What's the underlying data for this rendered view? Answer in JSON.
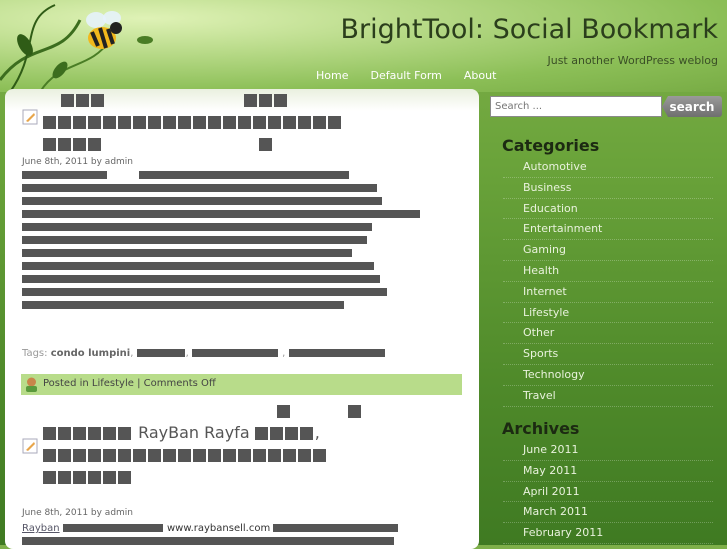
{
  "site": {
    "title": "BrightTool: Social Bookmark",
    "tagline": "Just another WordPress weblog"
  },
  "nav": {
    "items": [
      "Home",
      "Default Form",
      "About"
    ]
  },
  "post1": {
    "date_meta": "June 8th, 2011 by admin",
    "tags_label": "Tags:",
    "tag_first": "condo lumpini",
    "posted_text": "Posted in Lifestyle | Comments Off"
  },
  "post2": {
    "title_text": "RayBan Rayfa",
    "date_meta": "June 8th, 2011 by admin",
    "link_text": "Rayban",
    "url_text": "www.raybansell.com"
  },
  "sidebar": {
    "search": {
      "placeholder": "Search ...",
      "button_label": "search"
    },
    "categories_title": "Categories",
    "categories": [
      "Automotive",
      "Business",
      "Education",
      "Entertainment",
      "Gaming",
      "Health",
      "Internet",
      "Lifestyle",
      "Other",
      "Sports",
      "Technology",
      "Travel"
    ],
    "archives_title": "Archives",
    "archives": [
      "June 2011",
      "May 2011",
      "April 2011",
      "March 2011",
      "February 2011"
    ]
  }
}
